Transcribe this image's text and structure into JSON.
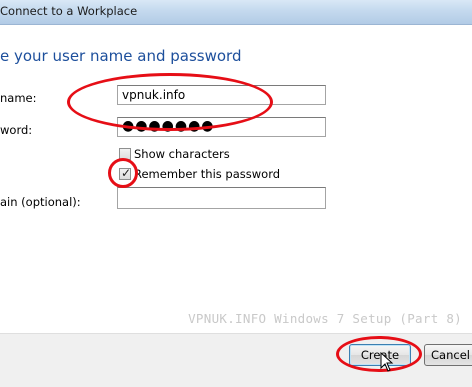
{
  "window": {
    "title": "Connect to a Workplace"
  },
  "heading": "e your user name and password",
  "form": {
    "username": {
      "label": "name:",
      "value": "vpnuk.info"
    },
    "password": {
      "label": "word:",
      "masked_value": "●●●●●●●"
    },
    "show_characters": {
      "label": "Show characters",
      "checked": false
    },
    "remember_password": {
      "label": "Remember this password",
      "checked": true
    },
    "domain": {
      "label": "ain (optional):",
      "value": ""
    }
  },
  "watermark": "VPNUK.INFO Windows 7 Setup (Part 8)",
  "buttons": {
    "create": "Create",
    "cancel": "Cancel"
  },
  "colors": {
    "heading": "#1d4f9c",
    "annotation": "#e60e16"
  },
  "icons": {
    "check": "✓",
    "cursor": "arrow-cursor-icon"
  }
}
